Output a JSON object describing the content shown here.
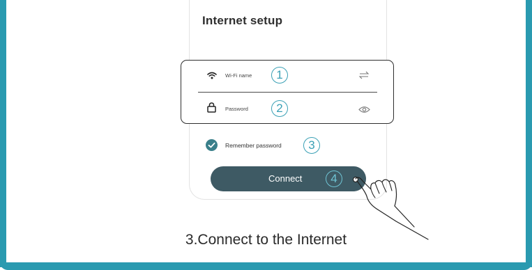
{
  "phone": {
    "title": "Internet setup",
    "wifi_field": {
      "label": "Wi-Fi name",
      "icon": "wifi-icon",
      "action_icon": "swap-arrows-icon"
    },
    "password_field": {
      "label": "Password",
      "icon": "lock-icon",
      "action_icon": "eye-icon"
    },
    "remember": {
      "label": "Remember password",
      "checked": true
    },
    "connect_button": {
      "label": "Connect"
    }
  },
  "steps": [
    "1",
    "2",
    "3",
    "4"
  ],
  "caption": "3.Connect to the Internet",
  "colors": {
    "frame": "#2a9ab0",
    "step_circle": "#3aa0b5",
    "button": "#3e5a64",
    "checkbox": "#3a7f8a"
  },
  "illustration": {
    "pointer": "hand-pointer-icon"
  }
}
